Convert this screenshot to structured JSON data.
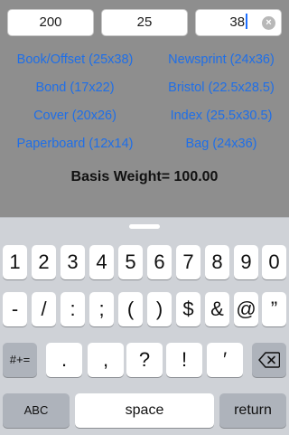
{
  "inputs": {
    "field1": {
      "value": "200"
    },
    "field2": {
      "value": "25"
    },
    "field3": {
      "value": "38"
    }
  },
  "grades": [
    "Book/Offset (25x38)",
    "Newsprint (24x36)",
    "Bond (17x22)",
    "Bristol (22.5x28.5)",
    "Cover (20x26)",
    "Index (25.5x30.5)",
    "Paperboard (12x14)",
    "Bag (24x36)"
  ],
  "result": {
    "label": "Basis Weight=",
    "value": "100.00"
  },
  "keyboard": {
    "row1": [
      "1",
      "2",
      "3",
      "4",
      "5",
      "6",
      "7",
      "8",
      "9",
      "0"
    ],
    "row2": [
      "-",
      "/",
      ":",
      ";",
      "(",
      ")",
      "$",
      "&",
      "@",
      "”"
    ],
    "row3": {
      "symbols_key": "#+=",
      "keys": [
        ".",
        ",",
        "?",
        "!",
        "′"
      ],
      "delete_icon": "delete-backward-icon"
    },
    "row4": {
      "abc_key": "ABC",
      "space_key": "space",
      "return_key": "return"
    }
  },
  "colors": {
    "background": "#8e8e8e",
    "link": "#1f6fe8",
    "keyboard_bg": "#cfd2d7",
    "key_bg": "#ffffff",
    "key_dark_bg": "#aeb3bb"
  }
}
